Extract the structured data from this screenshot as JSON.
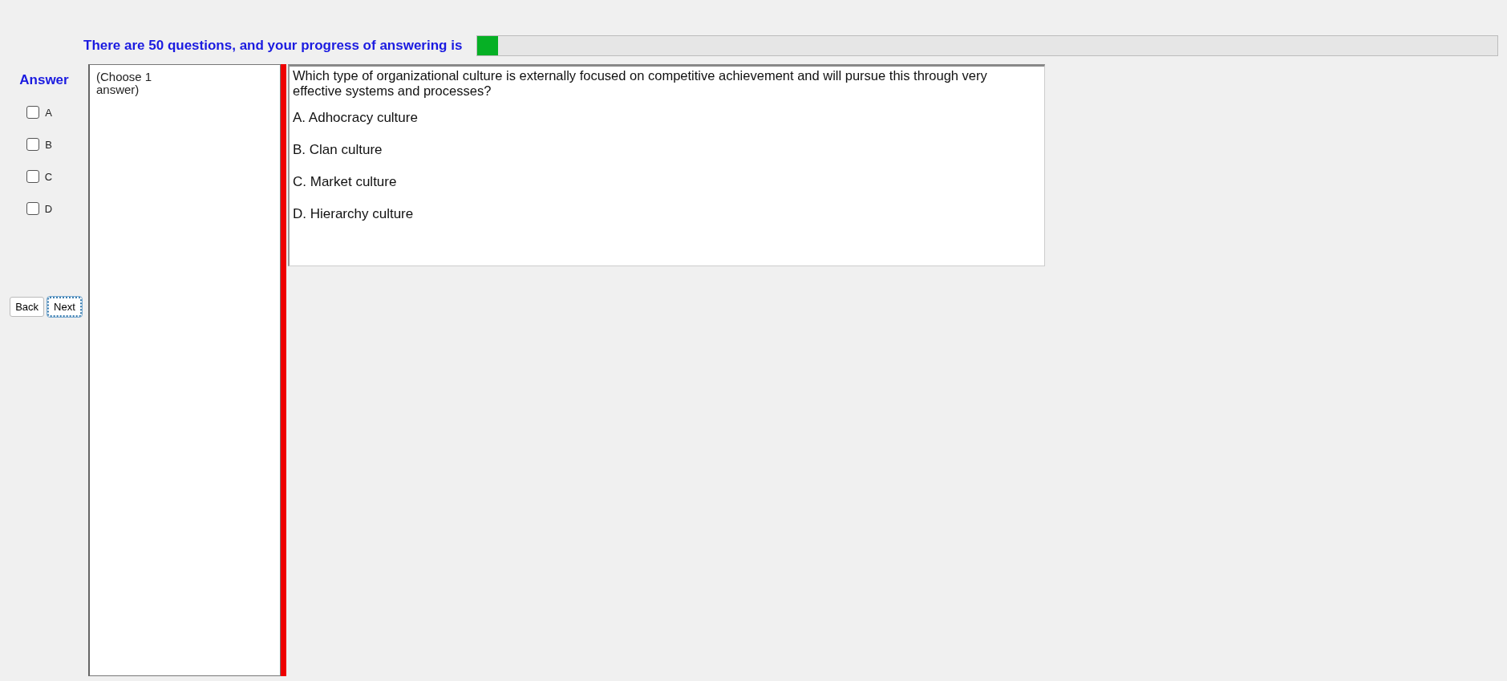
{
  "progress": {
    "label": "There are 50 questions, and your progress of answering is",
    "level": 0.02
  },
  "answer": {
    "title": "Answer",
    "options": [
      {
        "label": "A",
        "checked": false
      },
      {
        "label": "B",
        "checked": false
      },
      {
        "label": "C",
        "checked": false
      },
      {
        "label": "D",
        "checked": false
      }
    ]
  },
  "buttons": [
    {
      "label": "Back",
      "focused": false
    },
    {
      "label": "Next",
      "focused": true
    }
  ],
  "instruction": "(Choose 1\nanswer)",
  "question": {
    "text": "Which type of organizational culture is externally focused on competitive achievement and will pursue this through very effective systems and processes?",
    "choices": [
      "A.  Adhocracy culture",
      "B.  Clan culture",
      "C.  Market culture",
      "D.  Hierarchy culture"
    ]
  }
}
